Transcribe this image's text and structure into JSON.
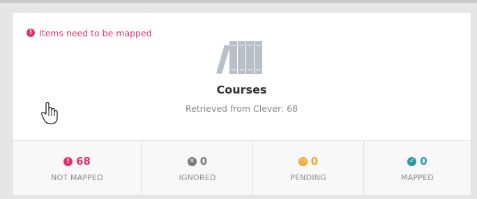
{
  "alert": {
    "text": "Items need to be mapped",
    "icon": "exclamation-circle-icon",
    "color": "#e0336a"
  },
  "section": {
    "icon": "books-icon",
    "title": "Courses",
    "subtitle": "Retrieved from Clever: 68"
  },
  "stats": [
    {
      "count": "68",
      "label": "NOT MAPPED",
      "icon": "exclamation-circle-icon",
      "glyph": "!",
      "color": "#e0336a"
    },
    {
      "count": "0",
      "label": "IGNORED",
      "icon": "x-circle-icon",
      "glyph": "✕",
      "color": "#7a7a7a"
    },
    {
      "count": "0",
      "label": "PENDING",
      "icon": "clock-icon",
      "glyph": "◷",
      "color": "#f0a72a"
    },
    {
      "count": "0",
      "label": "MAPPED",
      "icon": "check-circle-icon",
      "glyph": "✓",
      "color": "#2a9aa6"
    }
  ]
}
